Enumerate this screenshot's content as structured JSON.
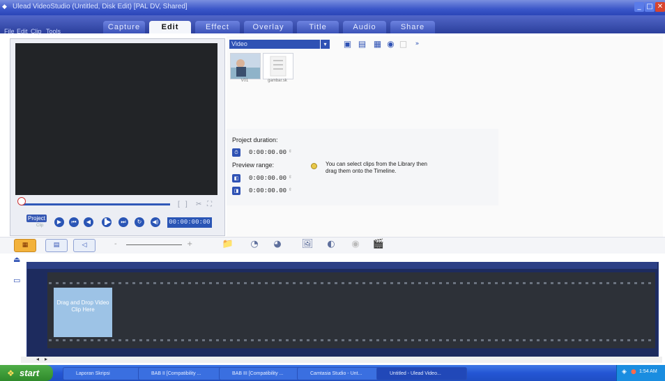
{
  "window": {
    "title": "Ulead VideoStudio (Untitled, Disk Edit) [PAL DV, Shared]",
    "controls": {
      "minimize": "_",
      "maximize": "□",
      "close": "✕"
    }
  },
  "menu": {
    "items": [
      "File",
      "Edit",
      "Clip",
      "Tools"
    ]
  },
  "tabs": [
    {
      "label": "Capture"
    },
    {
      "label": "Edit"
    },
    {
      "label": "Effect"
    },
    {
      "label": "Overlay"
    },
    {
      "label": "Title"
    },
    {
      "label": "Audio"
    },
    {
      "label": "Share"
    }
  ],
  "active_tab": "Edit",
  "preview": {
    "project_label": "Project",
    "clip_label": "Clip",
    "timecode": "00:00:00:00",
    "controls": [
      "▶",
      "⏮",
      "◀",
      "▐▶",
      "⏭",
      "↻",
      "◀)"
    ]
  },
  "library": {
    "category": "Video",
    "category_arrow": "▾",
    "toolbar_icons": [
      "folder-icon",
      "import-icon",
      "media-icon",
      "record-icon",
      "blank-icon",
      "more-icon"
    ],
    "thumbnails": [
      {
        "label": "V01"
      },
      {
        "label": "gambar.sk"
      }
    ]
  },
  "info": {
    "project_duration_label": "Project duration:",
    "project_duration": "0:00:00.00",
    "preview_range_label": "Preview range:",
    "preview_start": "0:00:00.00",
    "preview_end": "0:00:00.00",
    "hint": "You can select clips from the Library then drag them onto the Timeline."
  },
  "toolbar": {
    "view_buttons": [
      "▦",
      "▤",
      "◁"
    ],
    "zoom_minus": "-",
    "zoom_plus": "+",
    "tools": [
      "📁",
      "◔",
      "◕",
      "🖼",
      "◐",
      "◉",
      "🎬"
    ]
  },
  "timeline": {
    "drop_text": "Drag and Drop Video Clip Here",
    "scroll_left": "◂",
    "scroll_right": "▸"
  },
  "taskbar": {
    "start_label": "start",
    "items": [
      {
        "label": "Laporan Skripsi"
      },
      {
        "label": "BAB II [Compatibility ..."
      },
      {
        "label": "BAB III [Compatibility ..."
      },
      {
        "label": "Camtasia Studio - Unt..."
      },
      {
        "label": "Untitled - Ulead Video..."
      }
    ],
    "clock": "1:54 AM"
  },
  "colors": {
    "accent": "#2f52b4",
    "active_view": "#f3b23b",
    "drop_zone": "#9dc3e6"
  }
}
